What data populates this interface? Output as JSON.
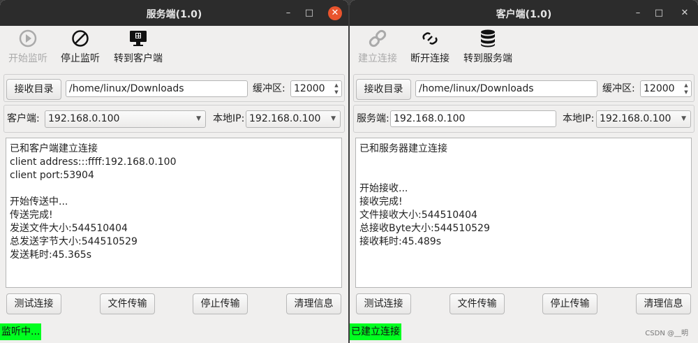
{
  "server": {
    "title": "服务端(1.0)",
    "toolbar": {
      "start": "开始监听",
      "stop": "停止监听",
      "switch": "转到客户端"
    },
    "recv_dir_button": "接收目录",
    "recv_dir_path": "/home/linux/Downloads",
    "buffer_label": "缓冲区:",
    "buffer_value": "12000",
    "peer_label": "客户端:",
    "peer_value": "192.168.0.100",
    "local_ip_label": "本地IP:",
    "local_ip_value": "192.168.0.100",
    "log": [
      "已和客户端建立连接",
      "client address:::ffff:192.168.0.100",
      "client port:53904",
      "",
      "开始传送中...",
      "传送完成!",
      "发送文件大小:544510404",
      "总发送字节大小:544510529",
      "发送耗时:45.365s"
    ],
    "buttons": {
      "test": "测试连接",
      "transfer": "文件传输",
      "stop": "停止传输",
      "clear": "清理信息"
    },
    "status": "监听中..."
  },
  "client": {
    "title": "客户端(1.0)",
    "toolbar": {
      "start": "建立连接",
      "stop": "断开连接",
      "switch": "转到服务端"
    },
    "recv_dir_button": "接收目录",
    "recv_dir_path": "/home/linux/Downloads",
    "buffer_label": "缓冲区:",
    "buffer_value": "12000",
    "peer_label": "服务端:",
    "peer_value": "192.168.0.100",
    "local_ip_label": "本地IP:",
    "local_ip_value": "192.168.0.100",
    "log": [
      "已和服务器建立连接",
      "",
      "",
      "开始接收...",
      "接收完成!",
      "文件接收大小:544510404",
      "总接收Byte大小:544510529",
      "接收耗时:45.489s"
    ],
    "buttons": {
      "test": "测试连接",
      "transfer": "文件传输",
      "stop": "停止传输",
      "clear": "清理信息"
    },
    "status": "已建立连接"
  },
  "window_controls": {
    "minimize": "–",
    "maximize": "□",
    "close": "✕"
  },
  "watermark": "CSDN @__明",
  "colors": {
    "status_bg": "#00ff20",
    "titlebar": "#2c2c2c",
    "close_active": "#e9542d"
  }
}
